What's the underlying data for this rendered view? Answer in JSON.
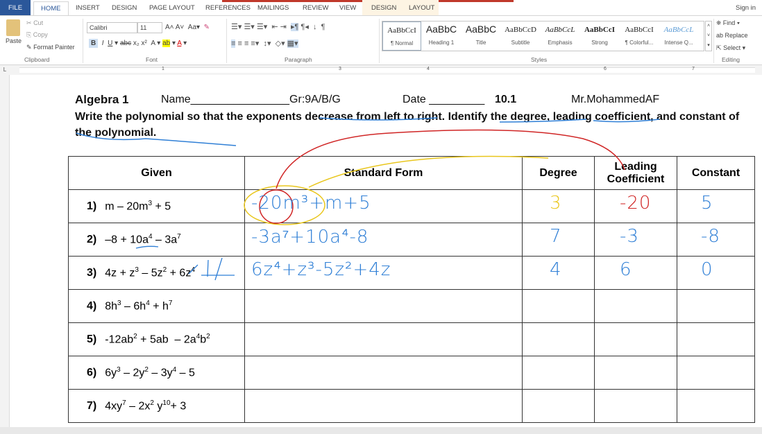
{
  "tabs": [
    "FILE",
    "HOME",
    "INSERT",
    "DESIGN",
    "PAGE LAYOUT",
    "REFERENCES",
    "MAILINGS",
    "REVIEW",
    "VIEW",
    "DESIGN",
    "LAYOUT"
  ],
  "sign_in": "Sign in",
  "clipboard": {
    "paste": "Paste",
    "cut": "Cut",
    "copy": "Copy",
    "format_painter": "Format Painter",
    "label": "Clipboard"
  },
  "font": {
    "name": "Calibri",
    "size": "11",
    "label": "Font"
  },
  "paragraph": {
    "label": "Paragraph"
  },
  "styles": {
    "label": "Styles",
    "items": [
      {
        "sample": "AaBbCcI",
        "name": "¶ Normal"
      },
      {
        "sample": "AaBbC",
        "name": "Heading 1"
      },
      {
        "sample": "AaBbC",
        "name": "Title"
      },
      {
        "sample": "AaBbCcD",
        "name": "Subtitle"
      },
      {
        "sample": "AaBbCcL",
        "name": "Emphasis"
      },
      {
        "sample": "AaBbCcI",
        "name": "Strong"
      },
      {
        "sample": "AaBbCcI",
        "name": "¶ Colorful..."
      },
      {
        "sample": "AaBbCcL",
        "name": "Intense Q..."
      }
    ]
  },
  "editing": {
    "find": "Find",
    "replace": "Replace",
    "select": "Select",
    "label": "Editing"
  },
  "ruler": [
    "1",
    "3",
    "4",
    "6",
    "7"
  ],
  "doc": {
    "course": "Algebra 1",
    "name": "Name________________Gr:9A/B/G",
    "date": "Date _________",
    "section": "10.1",
    "teacher": "Mr.MohammedAF",
    "instructions": "Write the polynomial so that the exponents decrease from left to right. Identify the degree, leading coefficient, and constant of the polynomial.",
    "headers": [
      "Given",
      "Standard Form",
      "Degree",
      "Leading Coefficient",
      "Constant"
    ],
    "rows": [
      {
        "num": "1)",
        "expr": [
          [
            "m – 20m",
            ""
          ],
          [
            "",
            "3"
          ],
          [
            " + 5",
            ""
          ]
        ],
        "standard": "-20m³+m+5",
        "degree": "3",
        "leading": "-20",
        "constant": "5"
      },
      {
        "num": "2)",
        "expr": [
          [
            "–8 + 10a",
            ""
          ],
          [
            "",
            "4"
          ],
          [
            " – 3a",
            ""
          ],
          [
            "",
            "7"
          ]
        ],
        "standard": "-3a⁷+10a⁴-8",
        "degree": "7",
        "leading": "-3",
        "constant": "-8"
      },
      {
        "num": "3)",
        "expr": [
          [
            "4z + z",
            ""
          ],
          [
            "",
            "3"
          ],
          [
            " – 5z",
            ""
          ],
          [
            "",
            "2"
          ],
          [
            " + 6z",
            ""
          ],
          [
            "",
            "4"
          ]
        ],
        "standard": "6z⁴+z³-5z²+4z",
        "degree": "4",
        "leading": "6",
        "constant": "0"
      },
      {
        "num": "4)",
        "expr": [
          [
            "8h",
            ""
          ],
          [
            "",
            "3"
          ],
          [
            " – 6h",
            ""
          ],
          [
            "",
            "4"
          ],
          [
            " + h",
            ""
          ],
          [
            "",
            "7"
          ]
        ],
        "standard": "",
        "degree": "",
        "leading": "",
        "constant": ""
      },
      {
        "num": "5)",
        "expr": [
          [
            "-12ab",
            ""
          ],
          [
            "",
            "2"
          ],
          [
            " + 5ab  – 2a",
            ""
          ],
          [
            "",
            "4"
          ],
          [
            "b",
            ""
          ],
          [
            "",
            "2"
          ]
        ],
        "standard": "",
        "degree": "",
        "leading": "",
        "constant": ""
      },
      {
        "num": "6)",
        "expr": [
          [
            "6y",
            ""
          ],
          [
            "",
            "3"
          ],
          [
            " – 2y",
            ""
          ],
          [
            "",
            "2"
          ],
          [
            " – 3y",
            ""
          ],
          [
            "",
            "4"
          ],
          [
            " – 5",
            ""
          ]
        ],
        "standard": "",
        "degree": "",
        "leading": "",
        "constant": ""
      },
      {
        "num": "7)",
        "expr": [
          [
            "4xy",
            ""
          ],
          [
            "",
            "7"
          ],
          [
            " – 2x",
            ""
          ],
          [
            "",
            "2"
          ],
          [
            " y",
            ""
          ],
          [
            "",
            "10"
          ],
          [
            "+ 3",
            ""
          ]
        ],
        "standard": "",
        "degree": "",
        "leading": "",
        "constant": ""
      }
    ]
  },
  "colors": {
    "blue": "#2f7fd6",
    "red": "#d02525",
    "yellow": "#e9c61c",
    "accent": "#2b579a"
  }
}
